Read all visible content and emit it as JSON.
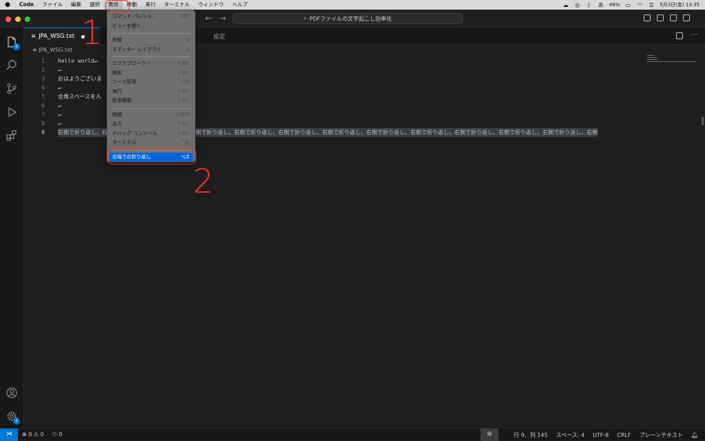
{
  "menubar": {
    "app": "Code",
    "items": [
      "ファイル",
      "編集",
      "選択",
      "表示",
      "移動",
      "実行",
      "ターミナル",
      "ウィンドウ",
      "ヘルプ"
    ],
    "active_index": 3,
    "battery": "48%",
    "input_source": "あ",
    "datetime": "5月3日(金)  13:35"
  },
  "titlebar": {
    "search_text": "PDFファイルの文字起こし効率化"
  },
  "tabs": [
    {
      "label": "JPA_WSG.txt",
      "modified": true
    },
    {
      "label": "設定"
    }
  ],
  "breadcrumb": "JPA_WSG.txt",
  "editor": {
    "current_line": 9,
    "lines": [
      {
        "n": "1",
        "text": "hello world↵"
      },
      {
        "n": "2",
        "text": "↵"
      },
      {
        "n": "3",
        "text": "おはようございま"
      },
      {
        "n": "4",
        "text": "↵"
      },
      {
        "n": "5",
        "text": "全角スペースを入"
      },
      {
        "n": "6",
        "text": "↵"
      },
      {
        "n": "7",
        "text": "↵"
      },
      {
        "n": "8",
        "text": "↵"
      },
      {
        "n": "9",
        "text": "右側で折り返し。右側で折り返し。右側で折り返し。右側で折り返し。右側で折り返し。右側で折り返し。右側で折り返し。右側で折り返し。右側で折り返し。右側で折り返し。右側で折り返し。右側で折り返し。右側"
      }
    ]
  },
  "view_menu": {
    "items": [
      {
        "label": "コマンド パレット...",
        "shortcut": "⇧⌘P"
      },
      {
        "label": "ビューを開く..."
      },
      {
        "sep": true
      },
      {
        "label": "外観",
        "shortcut": "›",
        "submenu": true
      },
      {
        "label": "エディター レイアウト",
        "shortcut": "›",
        "submenu": true
      },
      {
        "sep": true
      },
      {
        "label": "エクスプローラー",
        "shortcut": "⇧⌘E"
      },
      {
        "label": "検索",
        "shortcut": "⇧⌘F"
      },
      {
        "label": "ソース管理",
        "shortcut": "^⇧G"
      },
      {
        "label": "実行",
        "shortcut": "⇧⌘D"
      },
      {
        "label": "拡張機能",
        "shortcut": "⇧⌘X"
      },
      {
        "sep": true
      },
      {
        "label": "問題",
        "shortcut": "⇧⌘M"
      },
      {
        "label": "出力",
        "shortcut": "⇧⌘U"
      },
      {
        "label": "デバッグ コンソール",
        "shortcut": "⇧⌘Y"
      },
      {
        "label": "ターミナル",
        "shortcut": "^@"
      },
      {
        "sep": true
      },
      {
        "label": "右端での折り返し",
        "shortcut": "⌥Z",
        "highlighted": true
      }
    ]
  },
  "annotations": {
    "step1": "1",
    "step2": "2"
  },
  "statusbar": {
    "errors": "0",
    "warnings": "0",
    "ports": "0",
    "position": "行 9、列 145",
    "spaces": "スペース: 4",
    "encoding": "UTF-8",
    "eol": "CRLF",
    "language": "プレーンテキスト"
  },
  "colors": {
    "accent": "#0078d4",
    "annotation": "#e8372b",
    "menu_highlight": "#0a64d6"
  }
}
